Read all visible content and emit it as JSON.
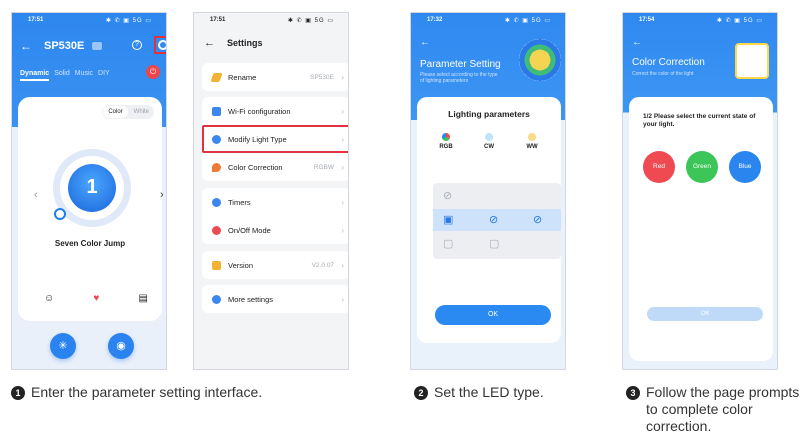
{
  "phone1": {
    "time": "17:51",
    "status_icons": "✱ ✆ ▣ 5G ▭",
    "title": "SP530E",
    "tabs": [
      "Dynamic",
      "Solid",
      "Music",
      "DIY"
    ],
    "segment": [
      "Color",
      "White"
    ],
    "mode_number": "1",
    "mode_name": "Seven Color Jump"
  },
  "phone2": {
    "time": "17:51",
    "status_icons": "✱ ✆ ▣ 5G ▭",
    "title": "Settings",
    "rename": {
      "label": "Rename",
      "value": "SP530E"
    },
    "wifi": {
      "label": "Wi-Fi configuration"
    },
    "modify": {
      "label": "Modify Light Type"
    },
    "color_correction": {
      "label": "Color Correction",
      "value": "RGBW"
    },
    "timers": {
      "label": "Timers"
    },
    "onoff": {
      "label": "On/Off Mode"
    },
    "version": {
      "label": "Version",
      "value": "V2.0.07"
    },
    "more": {
      "label": "More settings"
    }
  },
  "phone3": {
    "time": "17:32",
    "status_icons": "✱ ✆ ▣ 5G ▭",
    "title": "Parameter Setting",
    "subtitle": "Please select according to the type of lighting parameters",
    "card_title": "Lighting parameters",
    "types": [
      "RGB",
      "CW",
      "WW"
    ],
    "ok": "OK"
  },
  "phone4": {
    "time": "17:54",
    "status_icons": "✱ ✆ ▣ 5G ▭",
    "title": "Color Correction",
    "subtitle": "Correct the color of the light",
    "question": "1/2  Please select the current state of your light.",
    "colors": [
      "Red",
      "Green",
      "Blue"
    ],
    "ok": "OK"
  },
  "captions": {
    "step1_num": "1",
    "step1": "Enter the parameter setting interface.",
    "step2_num": "2",
    "step2": "Set the LED type.",
    "step3_num": "3",
    "step3": "Follow the page prompts to complete color correction."
  },
  "colors": {
    "accent": "#2a83ee",
    "highlight": "#e1323e",
    "red": "#ef4a52",
    "green": "#3cc65a",
    "blue": "#2a86ee"
  }
}
